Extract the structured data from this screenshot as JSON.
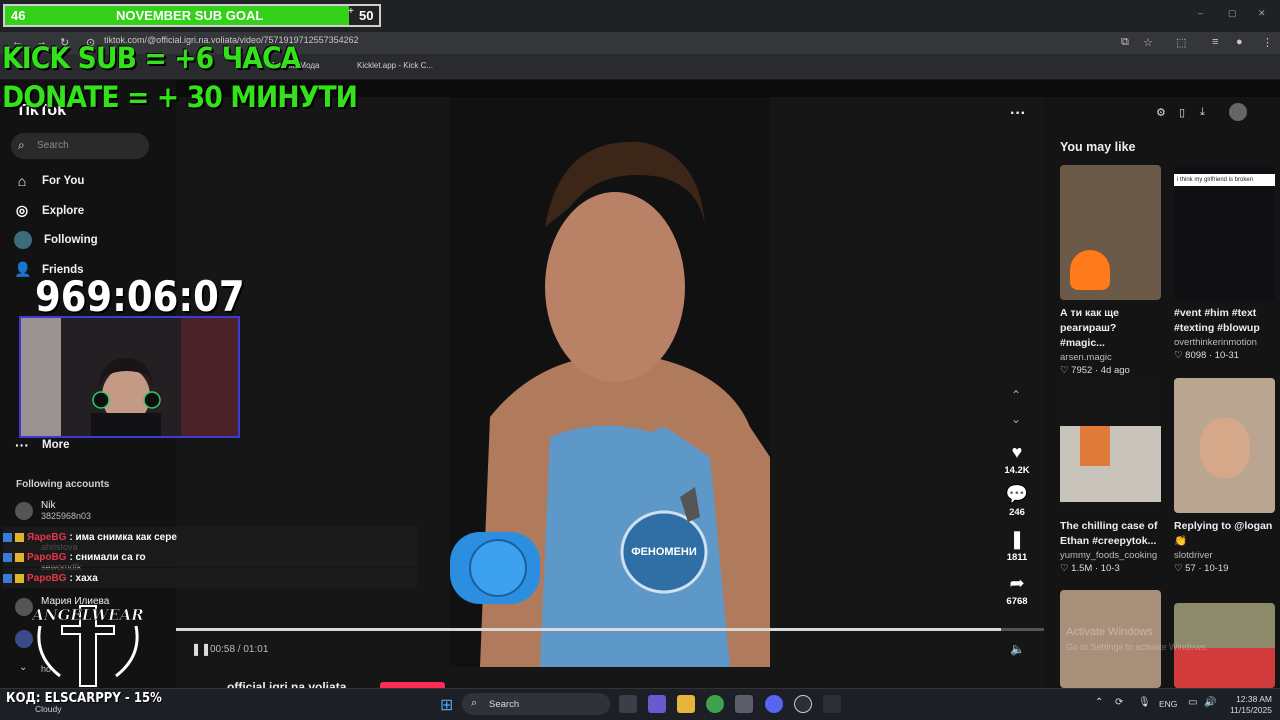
{
  "overlay": {
    "subgoal": {
      "left_value": "46",
      "title": "NOVEMBER SUB GOAL",
      "plus": "+",
      "right_value": "50",
      "progress": 0.92
    },
    "promo_line1": "KICK SUB = +6 ЧАСА",
    "promo_line2": "DONATE = + 30 МИНУТИ",
    "timer": "969:06:07",
    "promo_code": "КОД: ELSCARPPY - 15%",
    "logo_text": "ANGELWEAR"
  },
  "browser": {
    "url": "tiktok.com/@official.igri.na.voliata/video/7571919712557354262",
    "bookmarks": [
      "Мъжка Мода",
      "Kicklet.app - Kick C..."
    ],
    "window_controls": [
      "–",
      "▢",
      "✕"
    ]
  },
  "sidebar": {
    "logo": "TikTok",
    "search_placeholder": "Search",
    "nav": [
      {
        "label": "For You",
        "icon": "home-icon"
      },
      {
        "label": "Explore",
        "icon": "compass-icon"
      },
      {
        "label": "Following",
        "icon": "following-icon"
      },
      {
        "label": "Friends",
        "icon": "friends-icon"
      },
      {
        "label": "More",
        "icon": "more-icon"
      }
    ],
    "following_title": "Following accounts",
    "accounts": [
      {
        "name": "Nik",
        "sub": "3825968n03"
      },
      {
        "name": "",
        "sub": "ahristova"
      },
      {
        "name": "",
        "sub": "sewomdfk"
      },
      {
        "name": "Мария Илиева",
        "sub": ""
      },
      {
        "name": "",
        "sub": ""
      },
      {
        "name": "",
        "sub": "ho"
      }
    ]
  },
  "chat": [
    {
      "user": "ЯареBG",
      "msg": ": има снимка как сере"
    },
    {
      "user": "PapoBG",
      "msg": ": снимали са го"
    },
    {
      "user": "PapoBG",
      "msg": ": хаха"
    }
  ],
  "video": {
    "time": "00:58 / 01:01",
    "progress": 0.95,
    "badge_text": "ФЕНОМЕНИ",
    "author": "official.igri.na.voliata",
    "actions": [
      {
        "icon": "heart-icon",
        "count": "14.2K"
      },
      {
        "icon": "comment-icon",
        "count": "246"
      },
      {
        "icon": "bookmark-icon",
        "count": "1811"
      },
      {
        "icon": "share-icon",
        "count": "6768"
      }
    ]
  },
  "right_panel": {
    "title": "You may like",
    "cards": [
      {
        "title": "А ти как ще реагираш? #magic...",
        "author": "arsen.magic",
        "meta": "♡ 7952 · 4d ago",
        "thumb_color": "#6b5a48"
      },
      {
        "title": "#vent #him #text #texting #blowup",
        "author": "overthinkerinmotion",
        "meta": "♡ 8098 · 10-31",
        "thumb_color": "#0f0f14",
        "thumb_text": "i think my girlfriend is broken"
      },
      {
        "title": "The chilling case of Ethan #creepytok...",
        "author": "yummy_foods_cooking",
        "meta": "♡ 1.5M · 10-3",
        "thumb_color": "#c9c4bb"
      },
      {
        "title": "Replying to @logan 👏",
        "author": "slotdriver",
        "meta": "♡ 57 · 10-19",
        "thumb_color": "#b9a590"
      },
      {
        "title": "",
        "author": "",
        "meta": "",
        "thumb_color": "#a88f7a"
      },
      {
        "title": "",
        "author": "",
        "meta": "",
        "thumb_color": "#8c8a6a"
      }
    ],
    "activate_line1": "Activate Windows",
    "activate_line2": "Go to Settings to activate Windows."
  },
  "taskbar": {
    "weather": "Cloudy",
    "search": "Search",
    "lang": "ENG",
    "time": "12:38 AM",
    "date": "11/15/2025"
  }
}
